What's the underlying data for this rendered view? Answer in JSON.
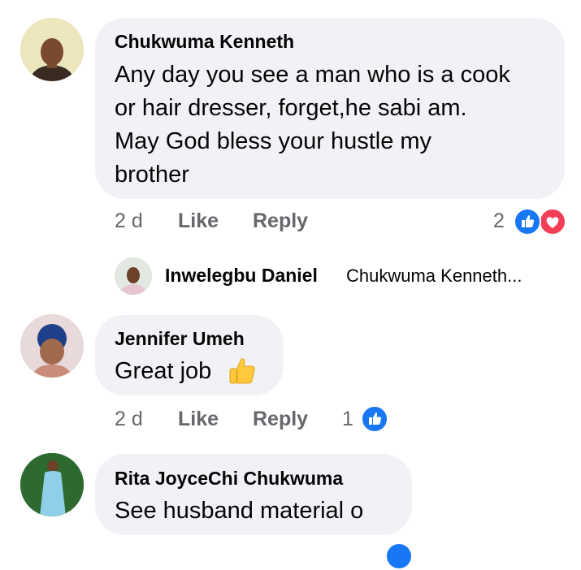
{
  "comments": [
    {
      "author": "Chukwuma Kenneth",
      "text_lines": [
        "Any day you see a man who is a cook",
        "or hair dresser, forget,he sabi am.",
        "May God bless your hustle my",
        "brother"
      ],
      "time": "2 d",
      "like_label": "Like",
      "reply_label": "Reply",
      "reaction_count": "2",
      "reactions": [
        "like-icon",
        "love-icon"
      ],
      "reply_preview": {
        "author": "Inwelegbu Daniel",
        "text": "Chukwuma Kenneth..."
      }
    },
    {
      "author": "Jennifer Umeh",
      "text": "Great job",
      "emoji": "thumbs-up-emoji",
      "time": "2 d",
      "like_label": "Like",
      "reply_label": "Reply",
      "reaction_count": "1",
      "reactions": [
        "like-icon"
      ]
    },
    {
      "author": "Rita JoyceChi Chukwuma",
      "text": "See husband material o"
    }
  ],
  "colors": {
    "bubble": "#f0f2f5",
    "meta_text": "#65676b",
    "like_blue": "#1877f2",
    "love_red": "#f33e58",
    "emoji_yellow": "#ffc83d"
  }
}
